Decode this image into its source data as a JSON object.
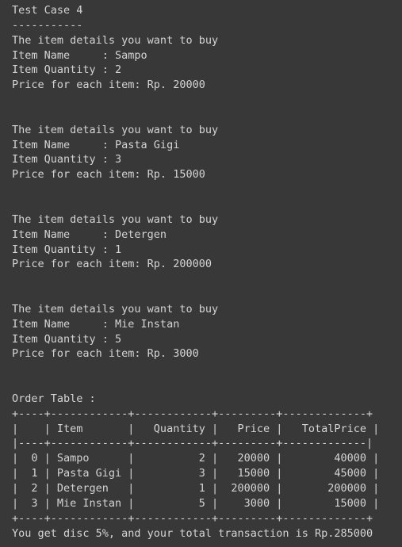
{
  "console": {
    "lines": [
      "Test Case 4",
      "-----------",
      "The item details you want to buy",
      "Item Name     : Sampo",
      "Item Quantity : 2",
      "Price for each item: Rp. 20000",
      "",
      "",
      "The item details you want to buy",
      "Item Name     : Pasta Gigi",
      "Item Quantity : 3",
      "Price for each item: Rp. 15000",
      "",
      "",
      "The item details you want to buy",
      "Item Name     : Detergen",
      "Item Quantity : 1",
      "Price for each item: Rp. 200000",
      "",
      "",
      "The item details you want to buy",
      "Item Name     : Mie Instan",
      "Item Quantity : 5",
      "Price for each item: Rp. 3000",
      "",
      "",
      "Order Table :",
      "+----+------------+------------+---------+-------------+",
      "|    | Item       |   Quantity |   Price |   TotalPrice |",
      "|----+------------+------------+---------+-------------|",
      "|  0 | Sampo      |          2 |   20000 |        40000 |",
      "|  1 | Pasta Gigi |          3 |   15000 |        45000 |",
      "|  2 | Detergen   |          1 |  200000 |       200000 |",
      "|  3 | Mie Instan |          5 |    3000 |        15000 |",
      "+----+------------+------------+---------+-------------+",
      "You get disc 5%, and your total transaction is Rp.285000"
    ]
  }
}
